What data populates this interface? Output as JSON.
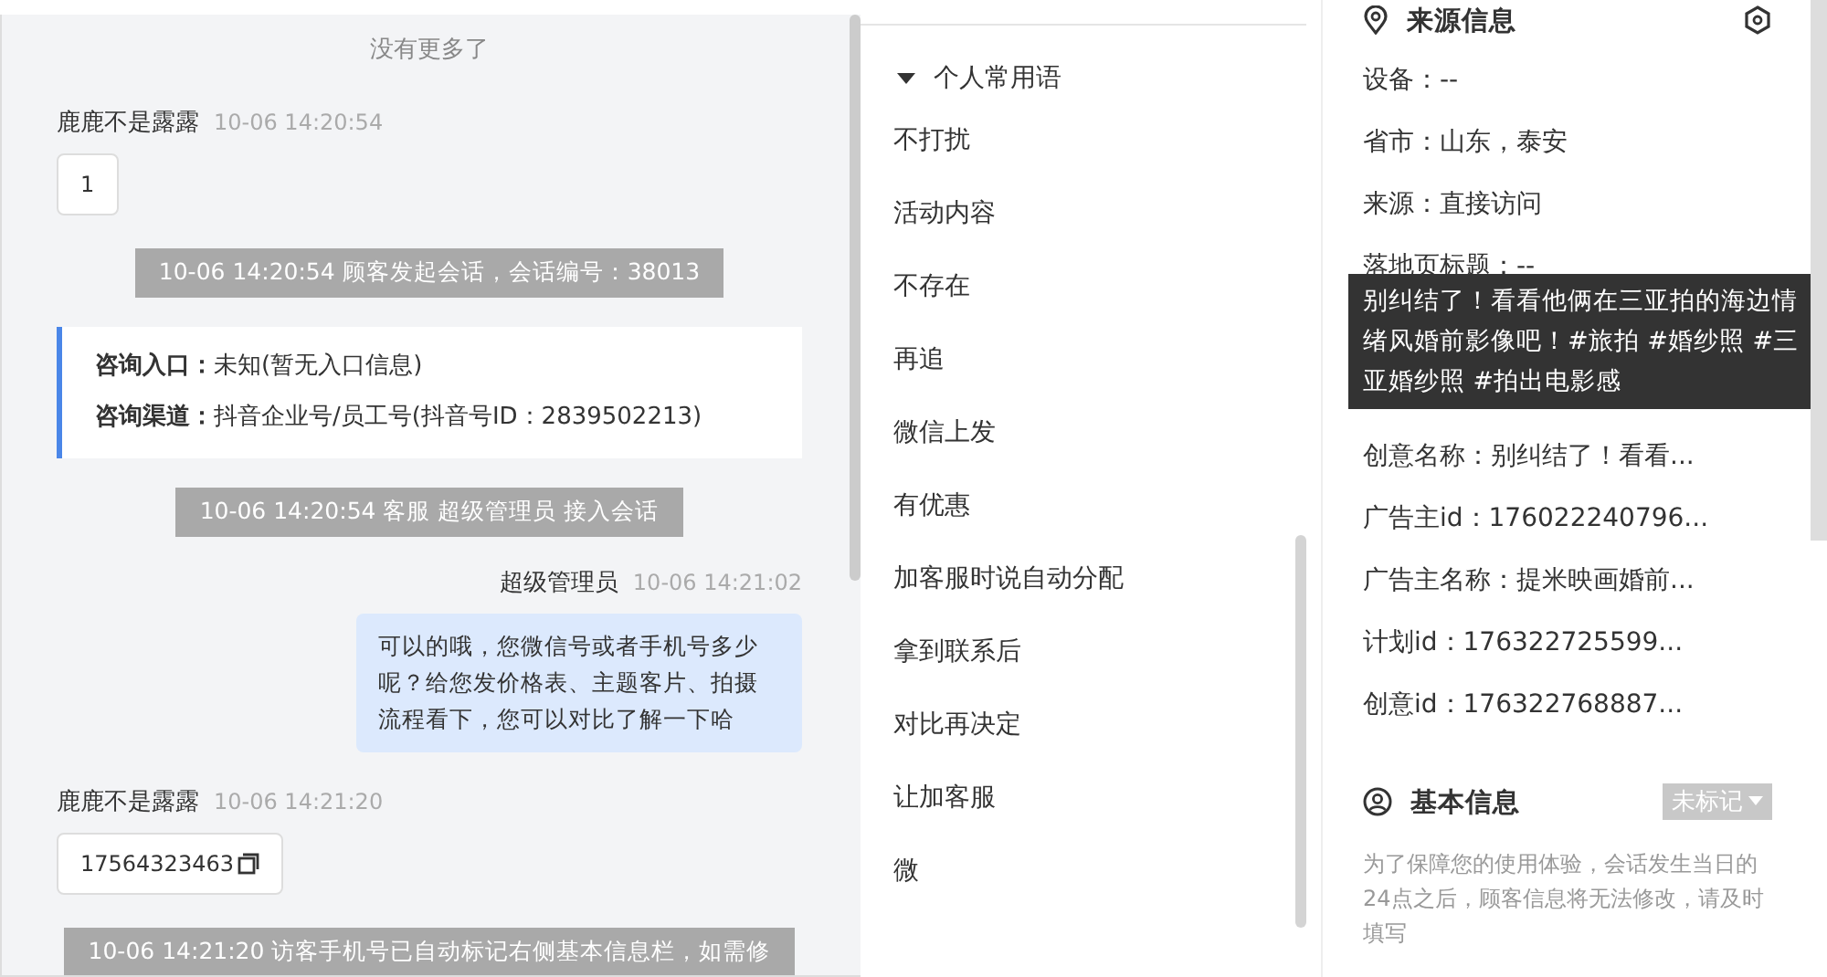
{
  "chat": {
    "no_more": "没有更多了",
    "messages": [
      {
        "kind": "visitor",
        "sender": "鹿鹿不是露露",
        "time": "10-06 14:20:54",
        "text": "1",
        "copyable": false
      },
      {
        "kind": "system",
        "text": "10-06 14:20:54 顾客发起会话，会话编号：38013"
      },
      {
        "kind": "info",
        "rows": [
          {
            "label": "咨询入口：",
            "value": "未知(暂无入口信息)"
          },
          {
            "label": "咨询渠道：",
            "value": "抖音企业号/员工号(抖音号ID：2839502213)"
          }
        ]
      },
      {
        "kind": "system",
        "text": "10-06 14:20:54 客服 超级管理员 接入会话"
      },
      {
        "kind": "agent",
        "sender": "超级管理员",
        "time": "10-06 14:21:02",
        "text": "可以的哦，您微信号或者手机号多少呢？给您发价格表、主题客片、拍摄流程看下，您可以对比了解一下哈"
      },
      {
        "kind": "visitor",
        "sender": "鹿鹿不是露露",
        "time": "10-06 14:21:20",
        "text": "17564323463",
        "copyable": true
      },
      {
        "kind": "system",
        "text": "10-06 14:21:20 访客手机号已自动标记右侧基本信息栏，如需修"
      }
    ]
  },
  "phrases": {
    "group": "个人常用语",
    "expanded": true,
    "items": [
      "不打扰",
      "活动内容",
      "不存在",
      "再追",
      "微信上发",
      "有优惠",
      "加客服时说自动分配",
      "拿到联系后",
      "对比再决定",
      "让加客服",
      "微"
    ]
  },
  "source_info": {
    "title": "来源信息",
    "fields": [
      "设备：--",
      "省市：山东，泰安",
      "来源：直接访问",
      "落地页标题：--"
    ],
    "tooltip": "别纠结了！看看他俩在三亚拍的海边情绪风婚前影像吧！#旅拍 #婚纱照 #三亚婚纱照 #拍出电影感",
    "fields_after": [
      "创意名称：别纠结了！看看...",
      "广告主id：176022240796...",
      "广告主名称：提米映画婚前...",
      "计划id：176322725599...",
      "创意id：176322768887..."
    ]
  },
  "basic_info": {
    "title": "基本信息",
    "tag": "未标记",
    "note": "为了保障您的使用体验，会话发生当日的24点之后，顾客信息将无法修改，请及时填写"
  }
}
